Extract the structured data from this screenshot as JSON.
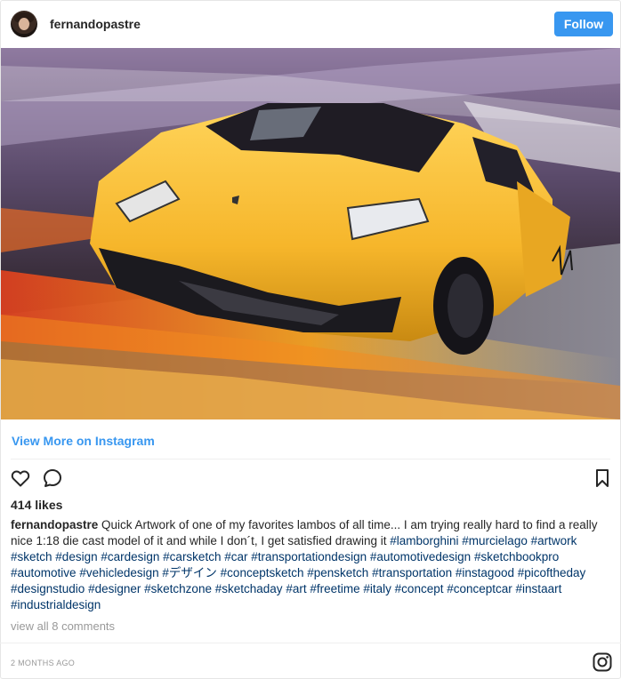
{
  "post": {
    "username": "fernandopastre",
    "follow_label": "Follow",
    "view_more": "View More on Instagram",
    "likes": "414 likes",
    "caption_user": "fernandopastre",
    "caption_text": " Quick Artwork of one of my favorites lambos of all time... I am trying really hard to find a really nice 1:18 die cast model of it and while I don´t, I get satisfied drawing it ",
    "hashtags": [
      "#lamborghini",
      "#murcielago",
      "#artwork",
      "#sketch",
      "#design",
      "#cardesign",
      "#carsketch",
      "#car",
      "#transportationdesign",
      "#automotivedesign",
      "#sketchbookpro",
      "#automotive",
      "#vehicledesign",
      "#デザイン",
      "#conceptsketch",
      "#pensketch",
      "#transportation",
      "#instagood",
      "#picoftheday",
      "#designstudio",
      "#designer",
      "#sketchzone",
      "#sketchaday",
      "#art",
      "#freetime",
      "#italy",
      "#concept",
      "#conceptcar",
      "#instaart",
      "#industrialdesign"
    ],
    "comments_link": "view all 8 comments",
    "timestamp": "2 MONTHS AGO"
  },
  "icons": {
    "heart": "heart-icon",
    "comment": "comment-icon",
    "bookmark": "bookmark-icon",
    "instagram": "instagram-logo-icon"
  },
  "colors": {
    "accent": "#3897f0",
    "hashtag": "#003569",
    "muted": "#999999"
  }
}
